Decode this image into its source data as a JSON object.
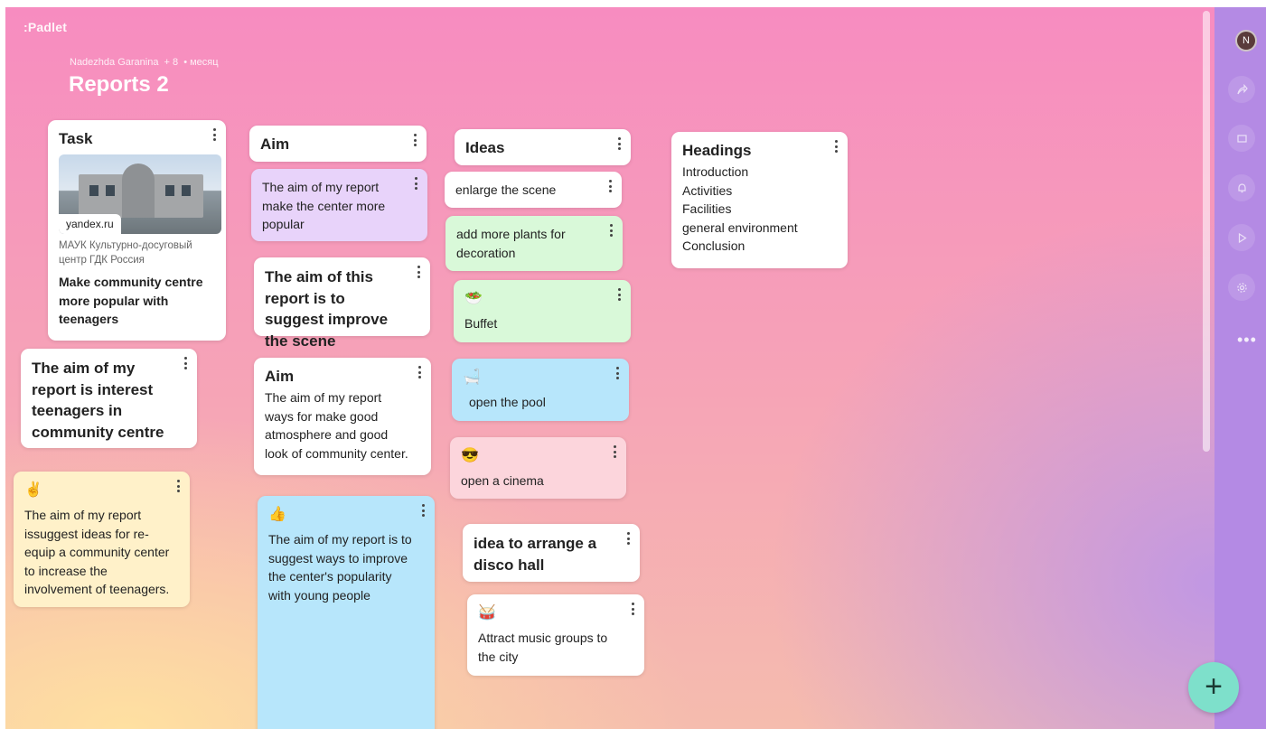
{
  "app": {
    "brand": ":Padlet"
  },
  "board": {
    "author": "Nadezhda Garanina",
    "plus": "+ 8",
    "period": "• месяц",
    "title": "Reports 2"
  },
  "user": {
    "avatar_initial": "N"
  },
  "rail": {
    "icons": [
      "share-icon",
      "remix-icon",
      "bell-icon",
      "play-icon",
      "settings-icon"
    ],
    "more_label": "•••"
  },
  "fab_label": "+",
  "cards": {
    "task": {
      "title": "Task",
      "link_domain": "yandex.ru",
      "source": "МАУК Культурно-досуговый центр ГДК Россия",
      "description": "Make community centre more popular with teenagers"
    },
    "aim_interest": {
      "text": "The aim of my report is interest teenagers in community centre"
    },
    "aim_equip": {
      "emoji": "✌️",
      "text": "The aim of my report issuggest ideas for re-equip a community center to increase the involvement of teenagers."
    },
    "aim_header": {
      "title": "Aim"
    },
    "aim_popular": {
      "text": "The aim of my report make the center more popular"
    },
    "aim_suggest": {
      "text": "The aim of this report is to suggest improve the scene"
    },
    "aim_atmosphere": {
      "title": "Aim",
      "text": "The aim of my report ways for make good atmosphere and good look of community center."
    },
    "aim_young": {
      "emoji": "👍",
      "text": "The aim of my report is to suggest ways to improve the center's popularity with young people"
    },
    "ideas_header": {
      "title": "Ideas"
    },
    "idea_scene": {
      "text": "enlarge the scene"
    },
    "idea_plants": {
      "text": "add more plants for decoration"
    },
    "idea_buffet": {
      "emoji": "🥗",
      "text": "Buffet"
    },
    "idea_pool": {
      "emoji": "🛁",
      "text": "open the pool"
    },
    "idea_cinema": {
      "emoji": "😎",
      "text": "open a cinema"
    },
    "idea_disco": {
      "text": "idea to arrange a disco hall"
    },
    "idea_music": {
      "emoji": "🥁",
      "text": "Attract music groups to the city"
    },
    "headings": {
      "title": "Headings",
      "items": [
        "Introduction",
        "Activities",
        "Facilities",
        "general environment",
        "Conclusion"
      ]
    }
  }
}
